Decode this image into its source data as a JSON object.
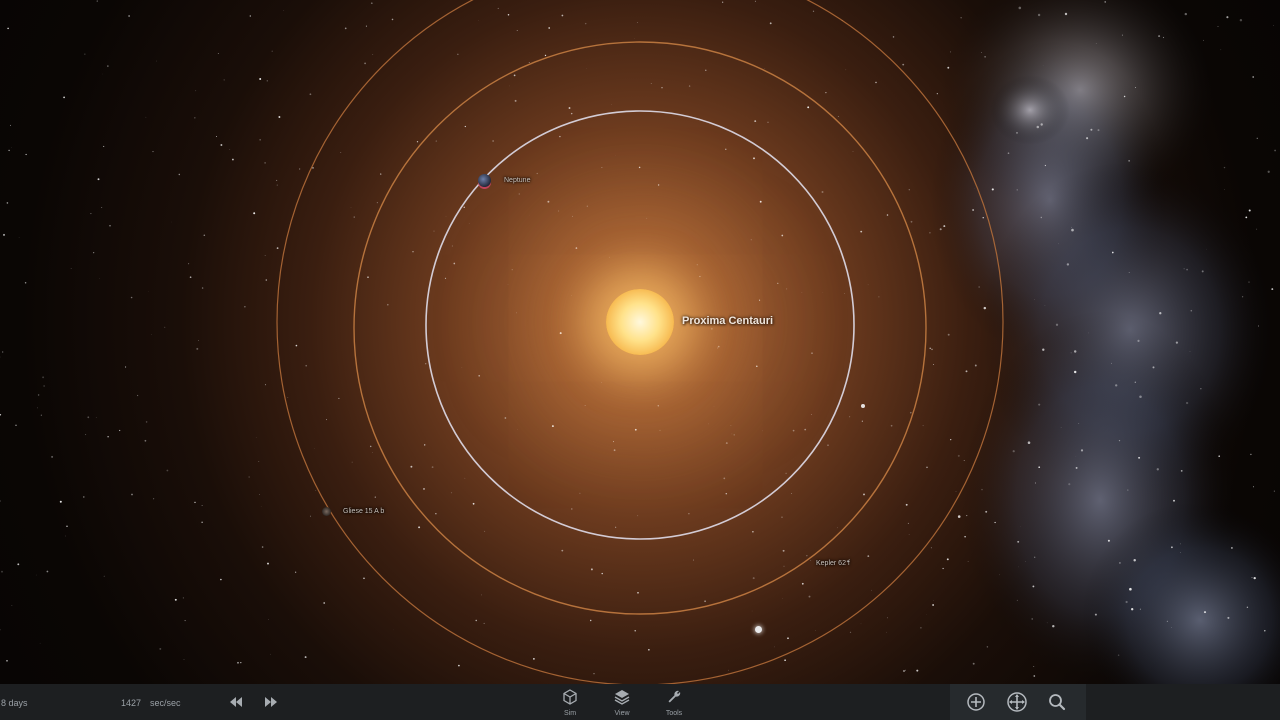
{
  "scene": {
    "star_name": "Proxima Centauri",
    "planets": [
      {
        "name": "Neptune"
      },
      {
        "name": "Gliese 15 A b"
      },
      {
        "name": "Kepler 62 f"
      }
    ]
  },
  "bottombar": {
    "elapsed": "8 days",
    "time_rate_value": "1427",
    "time_rate_unit": "sec/sec",
    "tabs": [
      {
        "label": "Sim",
        "icon": "cube-icon"
      },
      {
        "label": "View",
        "icon": "layers-icon"
      },
      {
        "label": "Tools",
        "icon": "wrench-icon"
      }
    ],
    "controls": [
      "rewind-icon",
      "fast-forward-icon",
      "add-icon",
      "move-icon",
      "search-icon"
    ]
  },
  "colors": {
    "bar_bg": "#1d1f21",
    "bar_panel": "#262a2d",
    "orbit_inner": "#d9d4df",
    "orbit_outer": "#c87a3e",
    "star_glow": "#ffe28a"
  }
}
